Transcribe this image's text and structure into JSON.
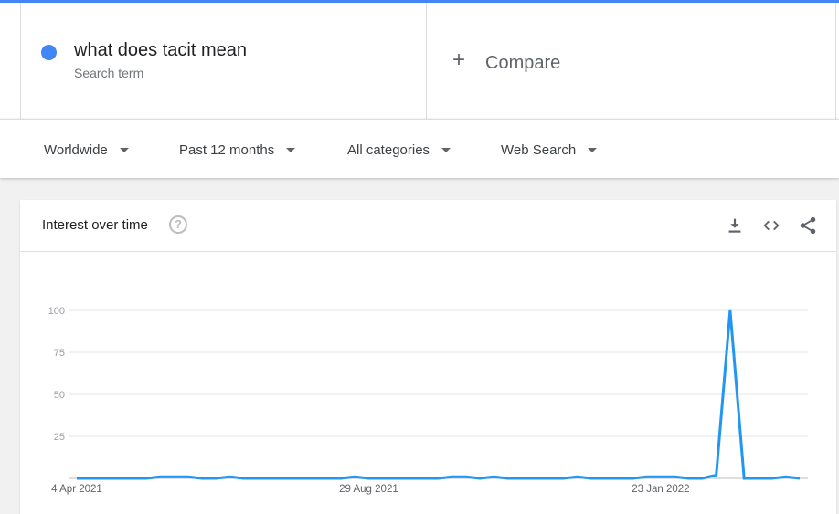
{
  "search_term": {
    "text": "what does tacit mean",
    "subtitle": "Search term",
    "color": "#4285f4"
  },
  "compare": {
    "icon": "plus-icon",
    "label": "Compare"
  },
  "filters": [
    {
      "label": "Worldwide"
    },
    {
      "label": "Past 12 months"
    },
    {
      "label": "All categories"
    },
    {
      "label": "Web Search"
    }
  ],
  "interest_over_time": {
    "title": "Interest over time",
    "icons": [
      "help-icon",
      "download-icon",
      "embed-code-icon",
      "share-icon"
    ]
  },
  "chart_data": {
    "type": "line",
    "title": "",
    "xlabel": "",
    "ylabel": "",
    "ylim": [
      0,
      100
    ],
    "yticks": [
      25,
      50,
      75,
      100
    ],
    "x_tick_labels": [
      "4 Apr 2021",
      "29 Aug 2021",
      "23 Jan 2022"
    ],
    "grid": true,
    "color": "#2196f3",
    "series": [
      {
        "values": [
          0,
          0,
          0,
          0,
          0,
          0,
          1,
          1,
          1,
          0,
          0,
          1,
          0,
          0,
          0,
          0,
          0,
          0,
          0,
          0,
          1,
          0,
          0,
          0,
          0,
          0,
          0,
          1,
          1,
          0,
          1,
          0,
          0,
          0,
          0,
          0,
          1,
          0,
          0,
          0,
          0,
          1,
          1,
          1,
          0,
          0,
          2,
          100,
          0,
          0,
          0,
          1,
          0
        ]
      }
    ]
  }
}
